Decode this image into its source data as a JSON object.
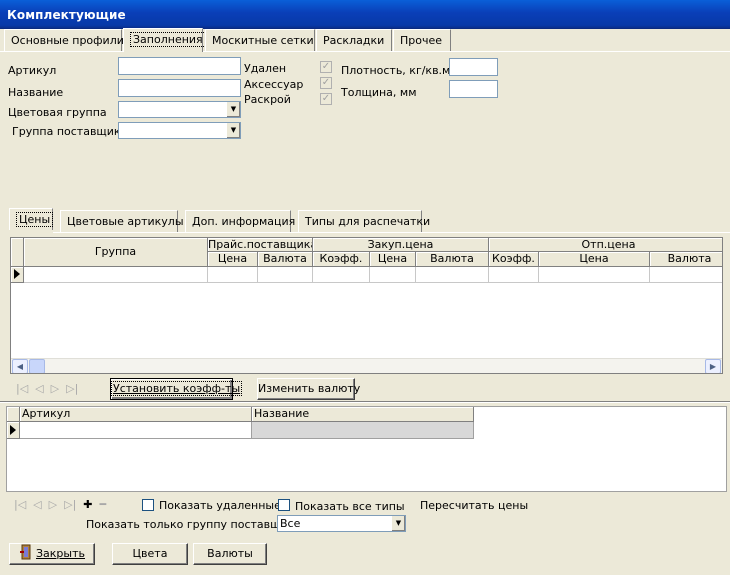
{
  "window": {
    "title": "Комплектующие"
  },
  "top_tabs": [
    "Основные профили",
    "Заполнения",
    "Москитные сетки",
    "Раскладки",
    "Прочее"
  ],
  "top_tabs_active": 1,
  "form": {
    "article_label": "Артикул",
    "name_label": "Название",
    "color_group_label": "Цветовая группа",
    "supplier_group_label": "Группа поставщика",
    "deleted_label": "Удален",
    "accessory_label": "Аксессуар",
    "cutting_label": "Раскрой",
    "density_label": "Плотность, кг/кв.м.",
    "thickness_label": "Толщина, мм"
  },
  "sub_tabs": [
    "Цены",
    "Цветовые артикулы",
    "Доп. информация",
    "Типы для распечатки"
  ],
  "sub_tabs_active": 0,
  "price_grid": {
    "group_header": "Группа",
    "supplier_price_header": "Прайс.поставщика",
    "purchase_price_header": "Закуп.цена",
    "sale_price_header": "Отп.цена",
    "price": "Цена",
    "currency": "Валюта",
    "coef": "Коэфф."
  },
  "buttons": {
    "set_coef": "Установить коэфф-ты",
    "change_currency": "Изменить валюту",
    "close": "Закрыть",
    "colors": "Цвета",
    "currencies": "Валюты"
  },
  "nav_glyphs": {
    "first": "|◁",
    "prev": "◁",
    "next": "▷",
    "last": "▷|",
    "add": "✚",
    "remove": "━"
  },
  "accessory_grid": {
    "article_header": "Артикул",
    "name_header": "Название"
  },
  "options": {
    "show_deleted": "Показать удаленные",
    "show_all_types": "Показать все типы",
    "recalc_prices": "Пересчитать цены",
    "supplier_only_label": "Показать только группу поставщика",
    "supplier_only_value": "Все"
  }
}
